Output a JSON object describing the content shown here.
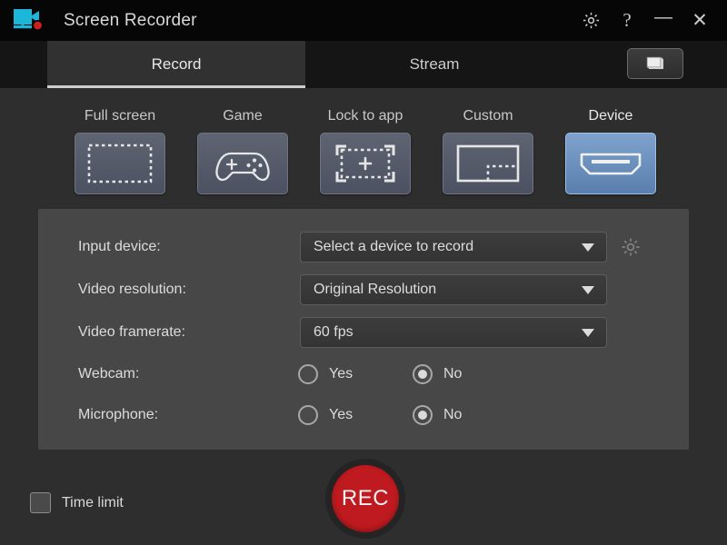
{
  "titlebar": {
    "app_title": "Screen Recorder",
    "logo_icon": "camcorder-monitor-icon",
    "logo_color": "#1bb6d8",
    "record_dot_color": "#cc1f1f",
    "settings_icon": "gear-icon",
    "help_icon": "question-mark-icon",
    "minimize_icon": "minimize-icon",
    "close_icon": "close-icon",
    "help_glyph": "?",
    "minimize_glyph": "—",
    "close_glyph": "✕",
    "background": "#060606"
  },
  "tabs": {
    "items": [
      {
        "label": "Record",
        "selected": true
      },
      {
        "label": "Stream",
        "selected": false
      }
    ],
    "layers_button_icon": "stacked-windows-icon"
  },
  "modes": {
    "items": [
      {
        "label": "Full screen",
        "icon": "fullscreen-dashed-rect-icon",
        "selected": false
      },
      {
        "label": "Game",
        "icon": "gamepad-icon",
        "selected": false
      },
      {
        "label": "Lock to app",
        "icon": "lock-to-app-crosshair-icon",
        "selected": false
      },
      {
        "label": "Custom",
        "icon": "custom-region-icon",
        "selected": false
      },
      {
        "label": "Device",
        "icon": "hdmi-connector-icon",
        "selected": true
      }
    ],
    "selected_accent": "#6f98c6"
  },
  "settings": {
    "input_device": {
      "label": "Input device:",
      "value": "Select a device to record",
      "gear_icon": "gear-icon"
    },
    "video_resolution": {
      "label": "Video resolution:",
      "value": "Original Resolution"
    },
    "video_framerate": {
      "label": "Video framerate:",
      "value": "60 fps"
    },
    "webcam": {
      "label": "Webcam:",
      "yes_label": "Yes",
      "no_label": "No",
      "selected": "No"
    },
    "microphone": {
      "label": "Microphone:",
      "yes_label": "Yes",
      "no_label": "No",
      "selected": "No"
    },
    "panel_background": "#474747"
  },
  "footer": {
    "time_limit_label": "Time limit",
    "time_limit_checked": false,
    "record_button_label": "REC",
    "record_button_color": "#bf1a1f"
  }
}
